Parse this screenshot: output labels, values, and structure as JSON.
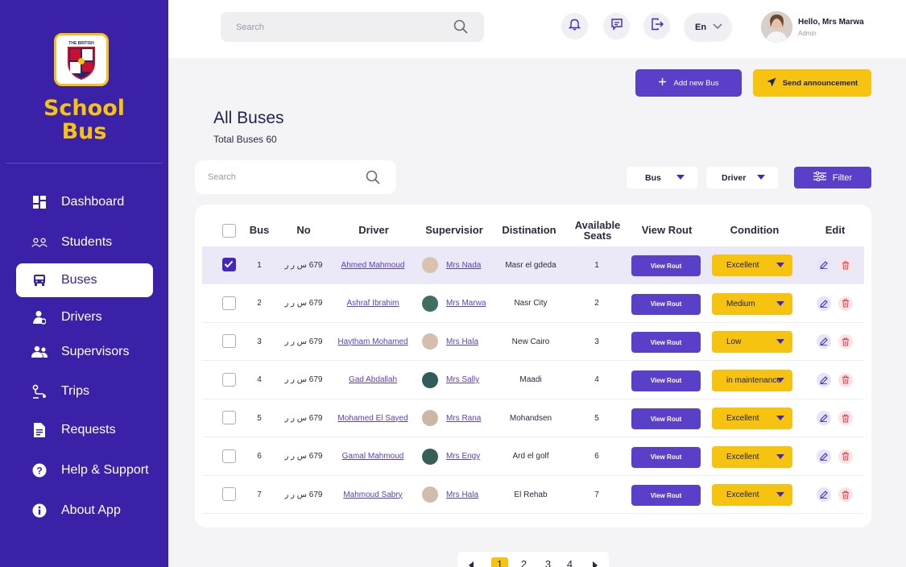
{
  "brand": {
    "logo_text": "THE BRITISH",
    "name_line1": "School",
    "name_line2": "Bus",
    "colors": {
      "primary": "#3B21A8",
      "accent": "#F6C310",
      "button": "#5A3FC8"
    }
  },
  "sidebar": {
    "items": [
      {
        "label": "Dashboard",
        "icon": "dashboard-icon",
        "active": false
      },
      {
        "label": "Students",
        "icon": "students-icon",
        "active": false
      },
      {
        "label": "Buses",
        "icon": "bus-icon",
        "active": true
      },
      {
        "label": "Drivers",
        "icon": "driver-icon",
        "active": false
      },
      {
        "label": "Supervisors",
        "icon": "supervisors-icon",
        "active": false
      },
      {
        "label": "Trips",
        "icon": "trips-icon",
        "active": false
      },
      {
        "label": "Requests",
        "icon": "requests-icon",
        "active": false
      },
      {
        "label": "Help & Support",
        "icon": "help-icon",
        "active": false
      },
      {
        "label": "About App",
        "icon": "info-icon",
        "active": false
      }
    ]
  },
  "topbar": {
    "search_placeholder": "Search",
    "icons": [
      "bell-icon",
      "message-icon",
      "logout-icon"
    ],
    "language": "En",
    "user_greeting": "Hello, Mrs Marwa",
    "user_role": "Admin"
  },
  "actions": {
    "add_bus": "Add new Bus",
    "send_announcement": "Send announcement"
  },
  "page": {
    "title": "All Buses",
    "subtitle": "Total Buses 60"
  },
  "filters": {
    "search_placeholder": "Search",
    "bus_dropdown": "Bus",
    "driver_dropdown": "Driver",
    "filter_button": "Filter"
  },
  "table": {
    "headers": {
      "bus": "Bus",
      "no": "No",
      "driver": "Driver",
      "supervisor": "Supervisior",
      "destination": "Distination",
      "seats_line1": "Available",
      "seats_line2": "Seats",
      "view": "View Rout",
      "condition": "Condition",
      "edit": "Edit"
    },
    "rows": [
      {
        "checked": true,
        "bus": "1",
        "no": "679 س ر ر",
        "driver": "Ahmed Mahmoud",
        "supervisor": "Mrs Nada",
        "destination": "Masr el gdeda",
        "seats": "1",
        "view": "View Rout",
        "condition": "Excellent"
      },
      {
        "checked": false,
        "bus": "2",
        "no": "679 س ر ر",
        "driver": "Ashraf Ibrahim",
        "supervisor": "Mrs Marwa",
        "destination": "Nasr City",
        "seats": "2",
        "view": "View Rout",
        "condition": "Medium"
      },
      {
        "checked": false,
        "bus": "3",
        "no": "679 س ر ر",
        "driver": "Haytham Mohamed",
        "supervisor": "Mrs Hala",
        "destination": "New Cairo",
        "seats": "3",
        "view": "View Rout",
        "condition": "Low"
      },
      {
        "checked": false,
        "bus": "4",
        "no": "679 س ر ر",
        "driver": "Gad Abdallah",
        "supervisor": "Mrs Sally",
        "destination": "Maadi",
        "seats": "4",
        "view": "View Rout",
        "condition": "in maintenance"
      },
      {
        "checked": false,
        "bus": "5",
        "no": "679 س ر ر",
        "driver": "Mohamed El Sayed",
        "supervisor": "Mrs Rana",
        "destination": "Mohandsen",
        "seats": "5",
        "view": "View Rout",
        "condition": "Excellent"
      },
      {
        "checked": false,
        "bus": "6",
        "no": "679 س ر ر",
        "driver": "Gamal Mahmoud",
        "supervisor": "Mrs Engy",
        "destination": "Ard el golf",
        "seats": "6",
        "view": "View Rout",
        "condition": "Excellent"
      },
      {
        "checked": false,
        "bus": "7",
        "no": "679 س ر ر",
        "driver": "Mahmoud Sabry",
        "supervisor": "Mrs Hala",
        "destination": "El Rehab",
        "seats": "7",
        "view": "View Rout",
        "condition": "Excellent"
      }
    ]
  },
  "pagination": {
    "pages": [
      "1",
      "2",
      "3",
      "4"
    ],
    "current": "1"
  }
}
